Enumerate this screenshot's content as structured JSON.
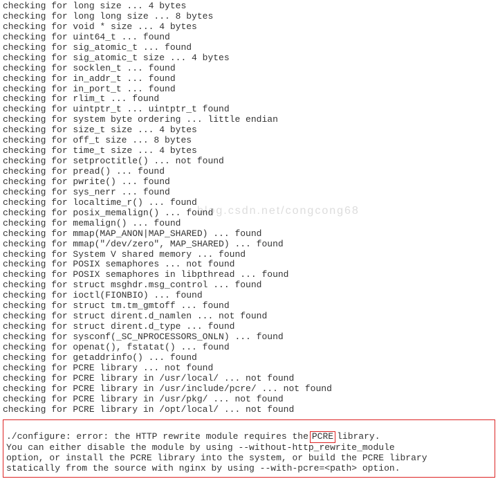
{
  "lines": [
    "checking for long size ... 4 bytes",
    "checking for long long size ... 8 bytes",
    "checking for void * size ... 4 bytes",
    "checking for uint64_t ... found",
    "checking for sig_atomic_t ... found",
    "checking for sig_atomic_t size ... 4 bytes",
    "checking for socklen_t ... found",
    "checking for in_addr_t ... found",
    "checking for in_port_t ... found",
    "checking for rlim_t ... found",
    "checking for uintptr_t ... uintptr_t found",
    "checking for system byte ordering ... little endian",
    "checking for size_t size ... 4 bytes",
    "checking for off_t size ... 8 bytes",
    "checking for time_t size ... 4 bytes",
    "checking for setproctitle() ... not found",
    "checking for pread() ... found",
    "checking for pwrite() ... found",
    "checking for sys_nerr ... found",
    "checking for localtime_r() ... found",
    "checking for posix_memalign() ... found",
    "checking for memalign() ... found",
    "checking for mmap(MAP_ANON|MAP_SHARED) ... found",
    "checking for mmap(\"/dev/zero\", MAP_SHARED) ... found",
    "checking for System V shared memory ... found",
    "checking for POSIX semaphores ... not found",
    "checking for POSIX semaphores in libpthread ... found",
    "checking for struct msghdr.msg_control ... found",
    "checking for ioctl(FIONBIO) ... found",
    "checking for struct tm.tm_gmtoff ... found",
    "checking for struct dirent.d_namlen ... not found",
    "checking for struct dirent.d_type ... found",
    "checking for sysconf(_SC_NPROCESSORS_ONLN) ... found",
    "checking for openat(), fstatat() ... found",
    "checking for getaddrinfo() ... found",
    "checking for PCRE library ... not found",
    "checking for PCRE library in /usr/local/ ... not found",
    "checking for PCRE library in /usr/include/pcre/ ... not found",
    "checking for PCRE library in /usr/pkg/ ... not found",
    "checking for PCRE library in /opt/local/ ... not found"
  ],
  "error": {
    "prefix": "./configure: error: the HTTP rewrite module requires the",
    "pcre": "PCRE",
    "suffix": "library.",
    "line2": "You can either disable the module by using --without-http_rewrite_module",
    "line3": "option, or install the PCRE library into the system, or build the PCRE library",
    "line4": "statically from the source with nginx by using --with-pcre=<path> option."
  },
  "watermark": "blog.csdn.net/congcong68"
}
